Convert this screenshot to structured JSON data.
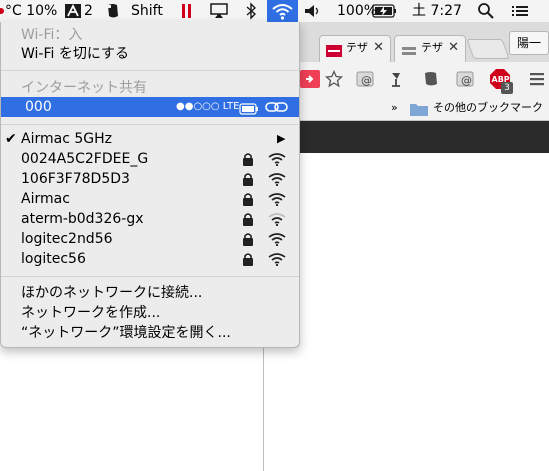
{
  "menubar": {
    "temp_text": "°C 10%",
    "adobe_badge": "2",
    "shift_label": "Shift",
    "volume_icon": "speaker-icon",
    "battery_text": "100%",
    "clock": "土 7:27"
  },
  "browser": {
    "tab1_title": "テザ",
    "tab2_title": "テザ",
    "profile_label": "陽一",
    "ext_badge": "3",
    "ext_abp": "ABP",
    "bookmarks_more": "»",
    "bookmarks_folder": "その他のブックマーク"
  },
  "wifi_menu": {
    "status": "Wi-Fi：入",
    "toggle": "Wi-Fi を切にする",
    "hotspot_header": "インターネット共有",
    "hotspot_name": "000",
    "hotspot_signal": "●●○○○ LTE",
    "current_network": "Airmac 5GHz",
    "networks": [
      {
        "name": "0024A5C2FDEE_G",
        "secured": true
      },
      {
        "name": "106F3F78D5D3",
        "secured": true
      },
      {
        "name": "Airmac",
        "secured": true
      },
      {
        "name": "aterm-b0d326-gx",
        "secured": true
      },
      {
        "name": "logitec2nd56",
        "secured": true
      },
      {
        "name": "logitec56",
        "secured": true
      }
    ],
    "other_network": "ほかのネットワークに接続...",
    "create_network": "ネットワークを作成...",
    "open_prefs": "“ネットワーク”環境設定を開く..."
  },
  "colors": {
    "highlight": "#2f6fe3",
    "menu_bg": "#ececec",
    "disabled_text": "#9d9d9d"
  }
}
